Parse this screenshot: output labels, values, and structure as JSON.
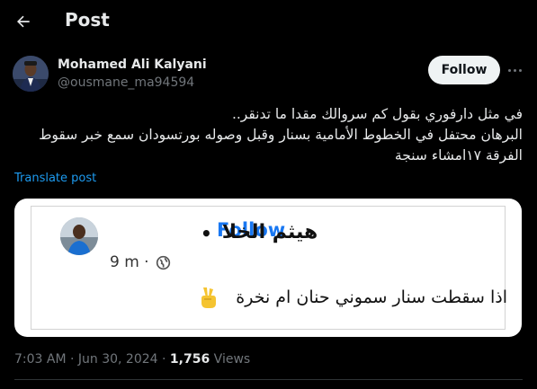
{
  "header": {
    "title": "Post"
  },
  "author": {
    "name": "Mohamed Ali Kalyani",
    "handle": "@ousmane_ma94594",
    "follow_label": "Follow"
  },
  "post": {
    "lines": [
      "في مثل دارفوري بقول كم سروالك مقدا ما تدنقر..",
      "البرهان محتفل في الخطوط الأمامية بسنار وقبل وصوله بورتسودان سمع خبر سقوط",
      "الفرقة ١٧امشاء سنجة"
    ],
    "translate_label": "Translate post"
  },
  "embedded": {
    "name": "هيثم الخلا",
    "dot": "•",
    "follow_label": "Follow",
    "time": "9 m ·",
    "text": "اذا سقطت سنار سموني حنان ام نخرة"
  },
  "meta": {
    "timestamp": "7:03 AM · Jun 30, 2024 · ",
    "views_count": "1,756",
    "views_label": " Views"
  },
  "icons": {
    "back": "arrow-left-icon",
    "more": "more-horizontal-icon",
    "globe": "globe-icon",
    "victory": "victory-hand-icon"
  },
  "colors": {
    "background": "#000000",
    "text": "#e7e9ea",
    "muted": "#71767b",
    "accent": "#1d9bf0",
    "fb_blue": "#1877f2"
  }
}
